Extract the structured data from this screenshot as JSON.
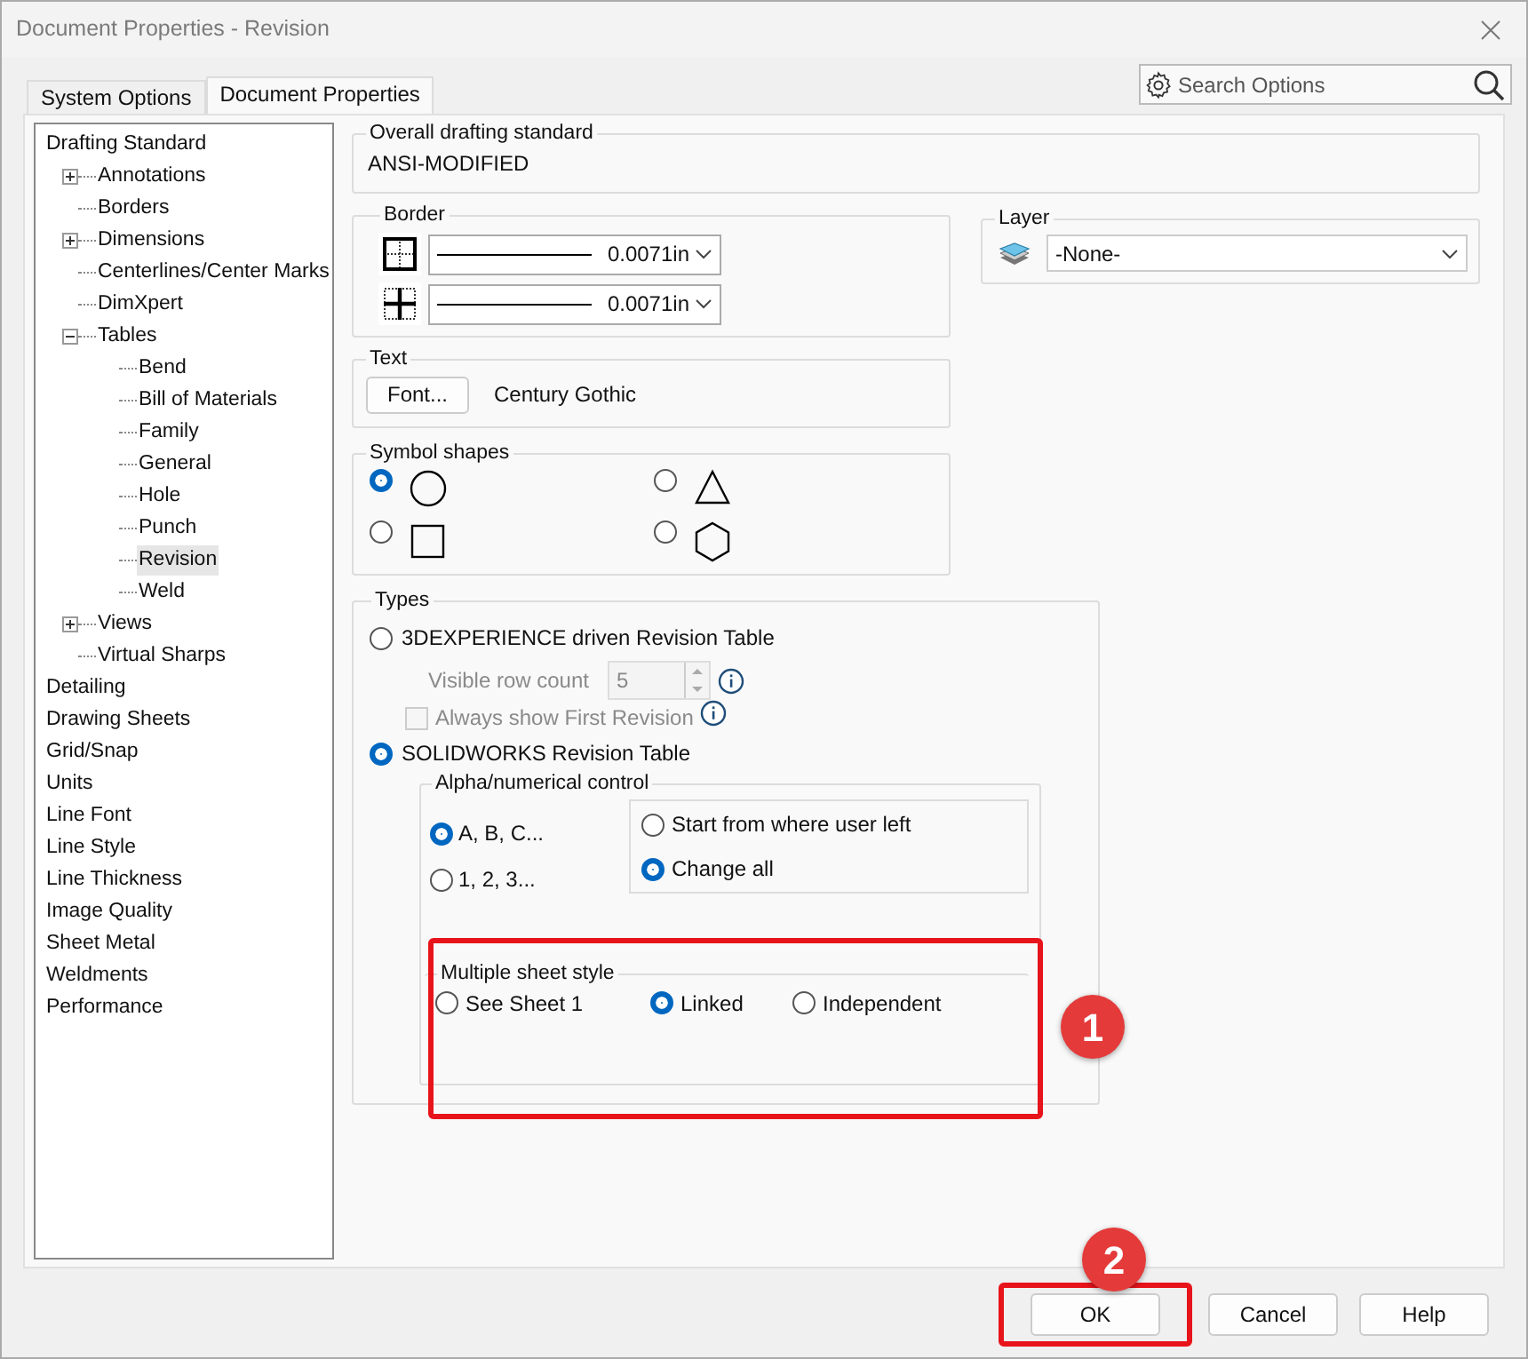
{
  "window": {
    "title": "Document Properties - Revision"
  },
  "tabs": [
    {
      "label": "System Options",
      "selected": false
    },
    {
      "label": "Document Properties",
      "selected": true
    }
  ],
  "search": {
    "placeholder": "Search Options"
  },
  "tree": [
    {
      "label": "Drafting Standard",
      "selected": false,
      "children": [
        {
          "label": "Annotations",
          "selected": false,
          "expanded": false
        },
        {
          "label": "Borders",
          "selected": false
        },
        {
          "label": "Dimensions",
          "selected": false,
          "expanded": false
        },
        {
          "label": "Centerlines/Center Marks",
          "selected": false
        },
        {
          "label": "DimXpert",
          "selected": false
        },
        {
          "label": "Tables",
          "selected": false,
          "expanded": true,
          "children": [
            {
              "label": "Bend",
              "selected": false
            },
            {
              "label": "Bill of Materials",
              "selected": false
            },
            {
              "label": "Family",
              "selected": false
            },
            {
              "label": "General",
              "selected": false
            },
            {
              "label": "Hole",
              "selected": false
            },
            {
              "label": "Punch",
              "selected": false
            },
            {
              "label": "Revision",
              "selected": true
            },
            {
              "label": "Weld",
              "selected": false
            }
          ]
        },
        {
          "label": "Views",
          "selected": false,
          "expanded": false
        },
        {
          "label": "Virtual Sharps",
          "selected": false
        }
      ]
    },
    {
      "label": "Detailing",
      "selected": false
    },
    {
      "label": "Drawing Sheets",
      "selected": false
    },
    {
      "label": "Grid/Snap",
      "selected": false
    },
    {
      "label": "Units",
      "selected": false
    },
    {
      "label": "Line Font",
      "selected": false
    },
    {
      "label": "Line Style",
      "selected": false
    },
    {
      "label": "Line Thickness",
      "selected": false
    },
    {
      "label": "Image Quality",
      "selected": false
    },
    {
      "label": "Sheet Metal",
      "selected": false
    },
    {
      "label": "Weldments",
      "selected": false
    },
    {
      "label": "Performance",
      "selected": false
    }
  ],
  "overall_standard": {
    "title": "Overall drafting standard",
    "value": "ANSI-MODIFIED"
  },
  "border": {
    "title": "Border",
    "lines": [
      {
        "kind": "outer",
        "value": "0.0071in"
      },
      {
        "kind": "inner",
        "value": "0.0071in"
      }
    ]
  },
  "layer": {
    "title": "Layer",
    "value": "-None-"
  },
  "text": {
    "title": "Text",
    "button": "Font...",
    "font": "Century Gothic"
  },
  "symbol_shapes": {
    "title": "Symbol shapes",
    "options": [
      {
        "kind": "circle",
        "selected": true
      },
      {
        "kind": "triangle",
        "selected": false
      },
      {
        "kind": "square",
        "selected": false
      },
      {
        "kind": "hexagon",
        "selected": false
      }
    ]
  },
  "types": {
    "title": "Types",
    "table_3dx": {
      "label": "3DEXPERIENCE driven Revision Table",
      "selected": false
    },
    "visible_row_count": {
      "label": "Visible row count",
      "value": "5",
      "disabled": true
    },
    "always_show_first": {
      "label": "Always show First Revision",
      "checked": false,
      "disabled": true
    },
    "table_sw": {
      "label": "SOLIDWORKS Revision Table",
      "selected": true
    },
    "alpha": {
      "title": "Alpha/numerical control",
      "options": [
        {
          "label": "A, B, C...",
          "selected": true
        },
        {
          "label": "1, 2, 3...",
          "selected": false
        }
      ],
      "start": [
        {
          "label": "Start from where user left",
          "selected": false
        },
        {
          "label": "Change all",
          "selected": true
        }
      ]
    },
    "multiple_sheet": {
      "title": "Multiple sheet style",
      "options": [
        {
          "label": "See Sheet 1",
          "selected": false
        },
        {
          "label": "Linked",
          "selected": true
        },
        {
          "label": "Independent",
          "selected": false
        }
      ]
    }
  },
  "step_badges": [
    {
      "label": "1"
    },
    {
      "label": "2"
    }
  ],
  "buttons": [
    {
      "label": "OK",
      "highlighted": true
    },
    {
      "label": "Cancel",
      "highlighted": false
    },
    {
      "label": "Help",
      "highlighted": false
    }
  ]
}
